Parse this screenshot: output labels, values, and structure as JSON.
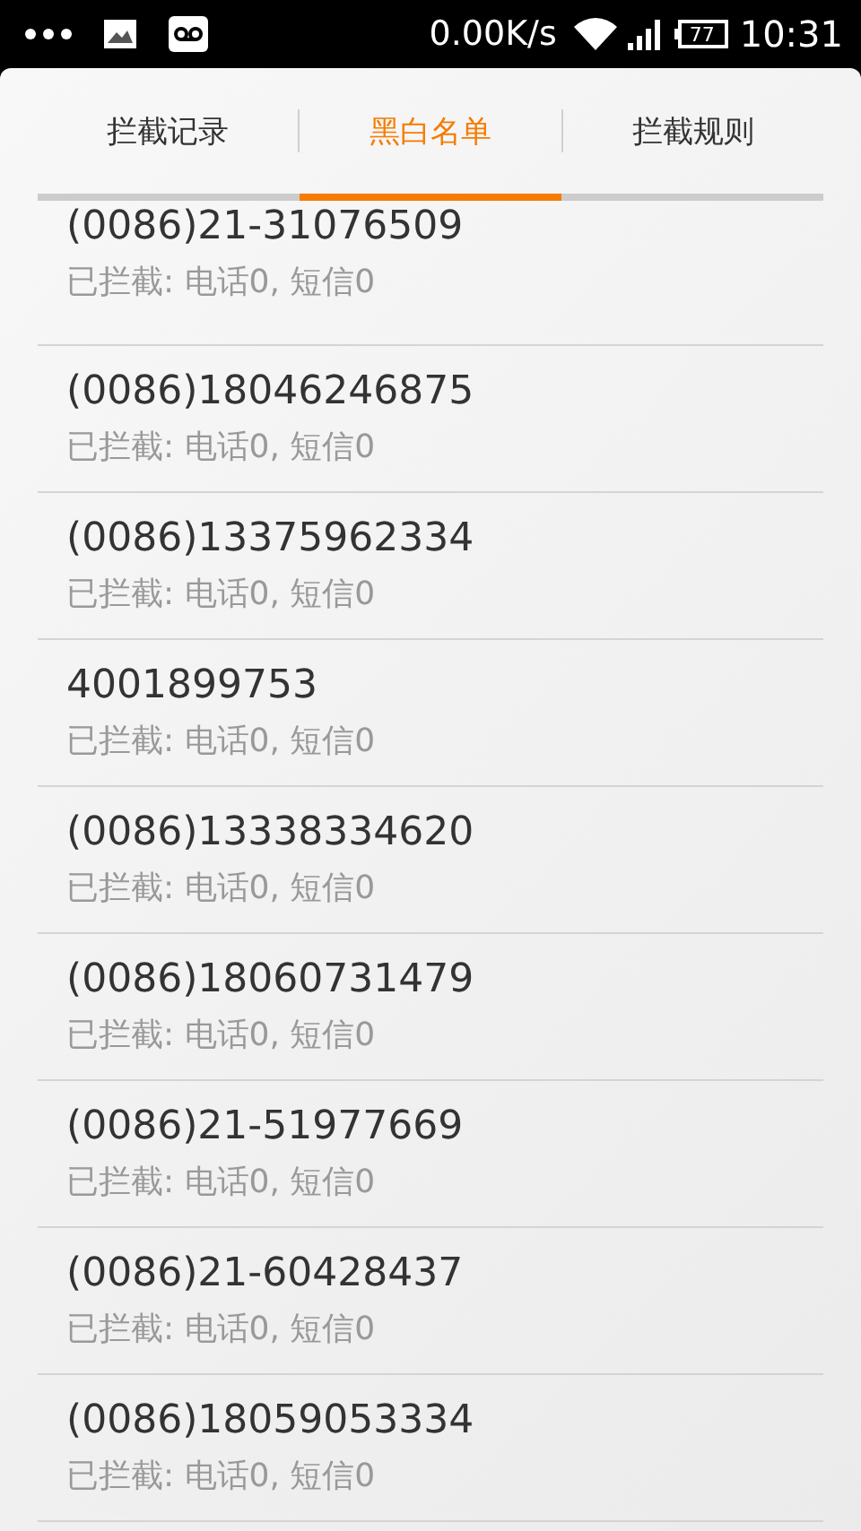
{
  "status_bar": {
    "network_speed": "0.00K/s",
    "battery": "77",
    "time": "10:31"
  },
  "tabs": [
    {
      "label": "拦截记录",
      "selected": false
    },
    {
      "label": "黑白名单",
      "selected": true
    },
    {
      "label": "拦截规则",
      "selected": false
    }
  ],
  "entries": [
    {
      "number": "(0086)21-31076509",
      "summary": "已拦截: 电话0, 短信0"
    },
    {
      "number": "(0086)18046246875",
      "summary": "已拦截: 电话0, 短信0"
    },
    {
      "number": "(0086)13375962334",
      "summary": "已拦截: 电话0, 短信0"
    },
    {
      "number": "4001899753",
      "summary": "已拦截: 电话0, 短信0"
    },
    {
      "number": "(0086)13338334620",
      "summary": "已拦截: 电话0, 短信0"
    },
    {
      "number": "(0086)18060731479",
      "summary": "已拦截: 电话0, 短信0"
    },
    {
      "number": "(0086)21-51977669",
      "summary": "已拦截: 电话0, 短信0"
    },
    {
      "number": "(0086)21-60428437",
      "summary": "已拦截: 电话0, 短信0"
    },
    {
      "number": "(0086)18059053334",
      "summary": "已拦截: 电话0, 短信0"
    }
  ]
}
